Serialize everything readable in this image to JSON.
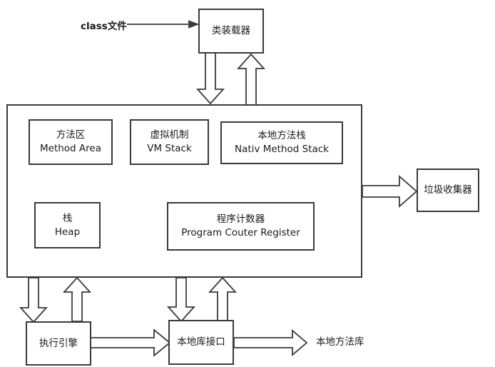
{
  "input_label": "class文件",
  "class_loader": "类装载器",
  "runtime": {
    "method_area": {
      "cn": "方法区",
      "en": "Method Area"
    },
    "vm_stack": {
      "cn": "虚拟机制",
      "en": "VM Stack"
    },
    "native_stack": {
      "cn": "本地方法栈",
      "en": "Nativ Method Stack"
    },
    "heap": {
      "cn": "栈",
      "en": "Heap"
    },
    "pc_register": {
      "cn": "程序计数器",
      "en": "Program Couter Register"
    }
  },
  "garbage_collector": "垃圾收集器",
  "execution_engine": "执行引擎",
  "native_interface": "本地库接口",
  "native_library": "本地方法库"
}
